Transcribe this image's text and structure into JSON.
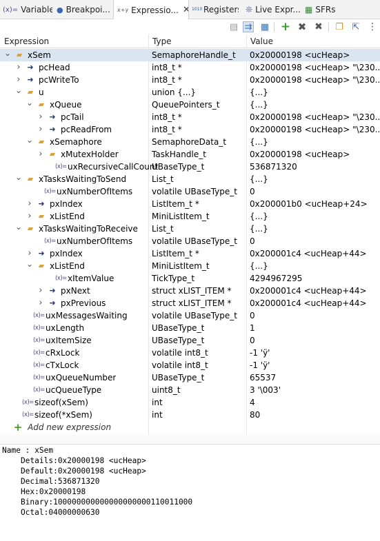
{
  "tabs": [
    {
      "label": "Variables",
      "icon": "(x)="
    },
    {
      "label": "Breakpoi...",
      "icon": "●"
    },
    {
      "label": "Expressio...",
      "icon": "x+y",
      "close": "✕"
    },
    {
      "label": "Registers",
      "icon": "1010"
    },
    {
      "label": "Live Expr...",
      "icon": "❊"
    },
    {
      "label": "SFRs",
      "icon": "▦"
    }
  ],
  "columns": {
    "expression": "Expression",
    "type": "Type",
    "value": "Value"
  },
  "rows": [
    {
      "name": "xSem",
      "type": "SemaphoreHandle_t",
      "value": "0x20000198 <ucHeap>"
    },
    {
      "name": "pcHead",
      "type": "int8_t *",
      "value": "0x20000198 <ucHeap> \"\\230..."
    },
    {
      "name": "pcWriteTo",
      "type": "int8_t *",
      "value": "0x20000198 <ucHeap> \"\\230..."
    },
    {
      "name": "u",
      "type": "union {...}",
      "value": "{...}"
    },
    {
      "name": "xQueue",
      "type": "QueuePointers_t",
      "value": "{...}"
    },
    {
      "name": "pcTail",
      "type": "int8_t *",
      "value": "0x20000198 <ucHeap> \"\\230..."
    },
    {
      "name": "pcReadFrom",
      "type": "int8_t *",
      "value": "0x20000198 <ucHeap> \"\\230..."
    },
    {
      "name": "xSemaphore",
      "type": "SemaphoreData_t",
      "value": "{...}"
    },
    {
      "name": "xMutexHolder",
      "type": "TaskHandle_t",
      "value": "0x20000198 <ucHeap>"
    },
    {
      "name": "uxRecursiveCallCount",
      "type": "UBaseType_t",
      "value": "536871320"
    },
    {
      "name": "xTasksWaitingToSend",
      "type": "List_t",
      "value": "{...}"
    },
    {
      "name": "uxNumberOfItems",
      "type": "volatile UBaseType_t",
      "value": "0"
    },
    {
      "name": "pxIndex",
      "type": "ListItem_t *",
      "value": "0x200001b0 <ucHeap+24>"
    },
    {
      "name": "xListEnd",
      "type": "MiniListItem_t",
      "value": "{...}"
    },
    {
      "name": "xTasksWaitingToReceive",
      "type": "List_t",
      "value": "{...}"
    },
    {
      "name": "uxNumberOfItems",
      "type": "volatile UBaseType_t",
      "value": "0"
    },
    {
      "name": "pxIndex",
      "type": "ListItem_t *",
      "value": "0x200001c4 <ucHeap+44>"
    },
    {
      "name": "xListEnd",
      "type": "MiniListItem_t",
      "value": "{...}"
    },
    {
      "name": "xItemValue",
      "type": "TickType_t",
      "value": "4294967295"
    },
    {
      "name": "pxNext",
      "type": "struct xLIST_ITEM *",
      "value": "0x200001c4 <ucHeap+44>"
    },
    {
      "name": "pxPrevious",
      "type": "struct xLIST_ITEM *",
      "value": "0x200001c4 <ucHeap+44>"
    },
    {
      "name": "uxMessagesWaiting",
      "type": "volatile UBaseType_t",
      "value": "0"
    },
    {
      "name": "uxLength",
      "type": "UBaseType_t",
      "value": "1"
    },
    {
      "name": "uxItemSize",
      "type": "UBaseType_t",
      "value": "0"
    },
    {
      "name": "cRxLock",
      "type": "volatile int8_t",
      "value": "-1 'ÿ'"
    },
    {
      "name": "cTxLock",
      "type": "volatile int8_t",
      "value": "-1 'ÿ'"
    },
    {
      "name": "uxQueueNumber",
      "type": "UBaseType_t",
      "value": "65537"
    },
    {
      "name": "ucQueueType",
      "type": "uint8_t",
      "value": "3 '\\003'"
    },
    {
      "name": "sizeof(xSem)",
      "type": "int",
      "value": "4"
    },
    {
      "name": "sizeof(*xSem)",
      "type": "int",
      "value": "80"
    }
  ],
  "add_expression": "Add new expression",
  "details": [
    "Name : xSem",
    "    Details:0x20000198 <ucHeap>",
    "    Default:0x20000198 <ucHeap>",
    "    Decimal:536871320",
    "    Hex:0x20000198",
    "    Binary:100000000000000000000110011000",
    "    Octal:04000000630"
  ]
}
